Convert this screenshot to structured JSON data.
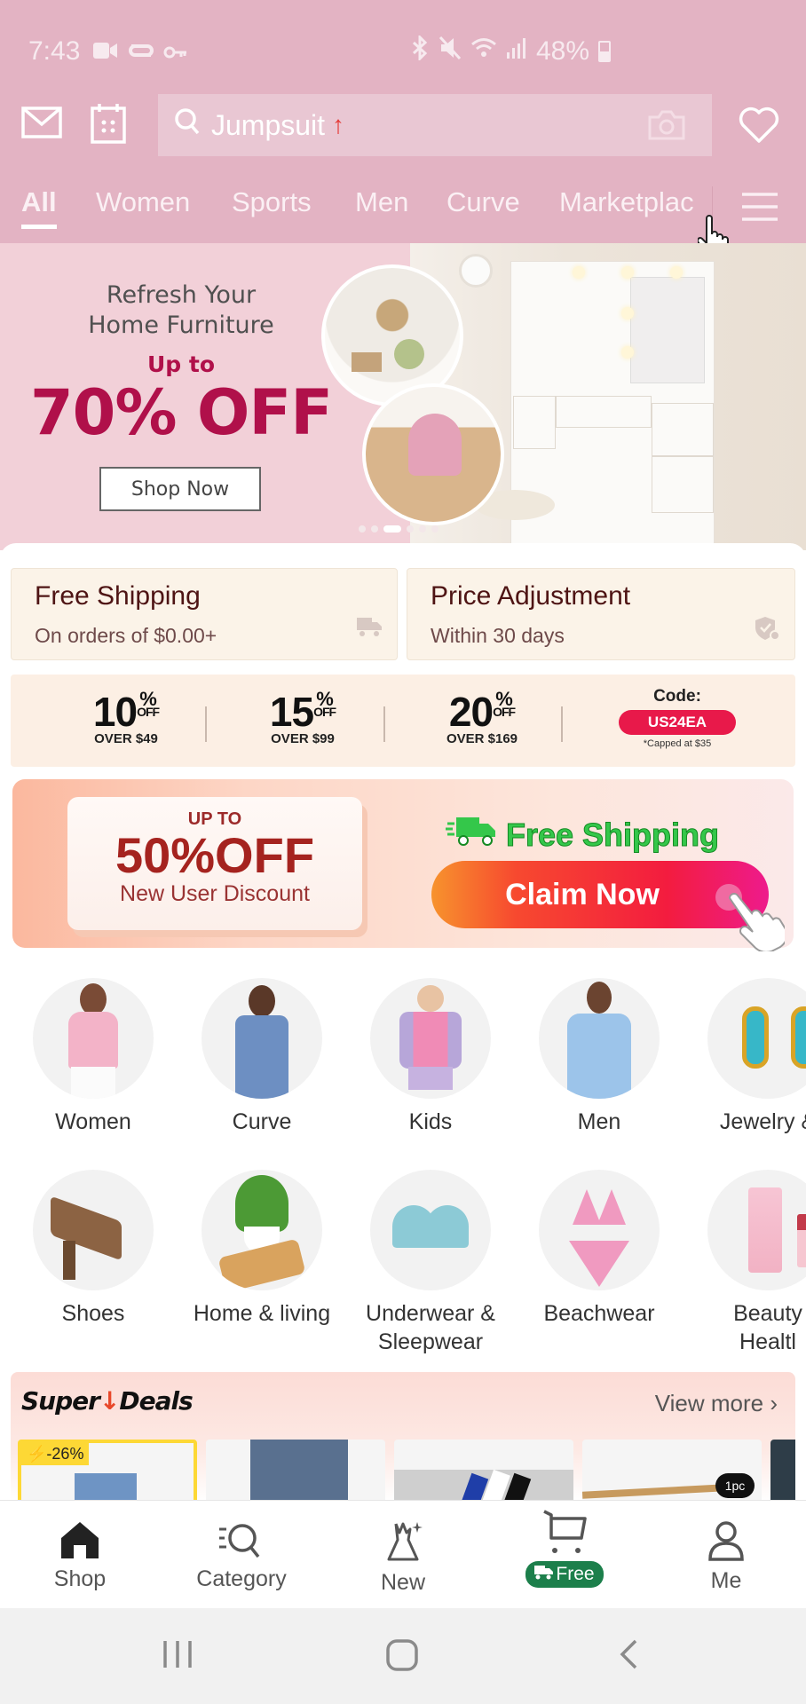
{
  "status_bar": {
    "time": "7:43",
    "left_icons": [
      "video-call-icon",
      "cloud-sync-icon",
      "vpn-key-icon"
    ],
    "right_icons": [
      "bluetooth-icon",
      "mute-icon",
      "wifi-icon",
      "signal-icon"
    ],
    "battery": "48%"
  },
  "header": {
    "search_placeholder": "Jumpsuit",
    "search_trend_icon": "trending-up-arrow",
    "icons": [
      "mail-icon",
      "calendar-icon",
      "camera-icon",
      "heart-icon"
    ]
  },
  "tabs": [
    {
      "label": "All",
      "active": true
    },
    {
      "label": "Women",
      "active": false
    },
    {
      "label": "Sports",
      "active": false
    },
    {
      "label": "Men",
      "active": false
    },
    {
      "label": "Curve",
      "active": false
    },
    {
      "label": "Marketplac",
      "active": false
    }
  ],
  "banner": {
    "line1": "Refresh Your",
    "line2": "Home Furniture",
    "upto": "Up to",
    "discount": "70% OFF",
    "button": "Shop Now",
    "slides": 6,
    "active_slide": 3
  },
  "services": [
    {
      "title": "Free Shipping",
      "subtitle": "On orders of $0.00+",
      "icon": "truck-icon"
    },
    {
      "title": "Price Adjustment",
      "subtitle": "Within 30 days",
      "icon": "shield-check-icon"
    }
  ],
  "coupons": {
    "tiers": [
      {
        "percent": "10",
        "off": "OFF",
        "threshold": "OVER $49"
      },
      {
        "percent": "15",
        "off": "OFF",
        "threshold": "OVER $99"
      },
      {
        "percent": "20",
        "off": "OFF",
        "threshold": "OVER $169"
      }
    ],
    "code_label": "Code:",
    "code": "US24EA",
    "cap_note": "*Capped at $35"
  },
  "new_user_promo": {
    "upto": "UP TO",
    "discount": "50%OFF",
    "subtitle": "New User Discount",
    "free_shipping": "Free Shipping",
    "claim_button": "Claim Now"
  },
  "categories_row1": [
    {
      "label": "Women"
    },
    {
      "label": "Curve"
    },
    {
      "label": "Kids"
    },
    {
      "label": "Men"
    },
    {
      "label": "Jewelry &"
    }
  ],
  "categories_row2": [
    {
      "label": "Shoes"
    },
    {
      "label": "Home & living"
    },
    {
      "label": "Underwear &",
      "label2": "Sleepwear"
    },
    {
      "label": "Beachwear"
    },
    {
      "label": "Beauty",
      "label2": "Healtl"
    }
  ],
  "super_deals": {
    "logo_a": "Super",
    "logo_b": "Deals",
    "view_more": "View more",
    "items": [
      {
        "badge": "-26%"
      },
      {},
      {},
      {
        "tag": "1pc"
      }
    ]
  },
  "bottom_nav": [
    {
      "label": "Shop",
      "active": true
    },
    {
      "label": "Category"
    },
    {
      "label": "New"
    },
    {
      "label": "Free",
      "badge": true
    },
    {
      "label": "Me"
    }
  ],
  "colors": {
    "header_bg": "#e3b3c3",
    "banner_accent": "#b0104a",
    "code_pill": "#e8194a",
    "free_badge": "#1c7f4b",
    "deal_badge": "#fdd835"
  }
}
